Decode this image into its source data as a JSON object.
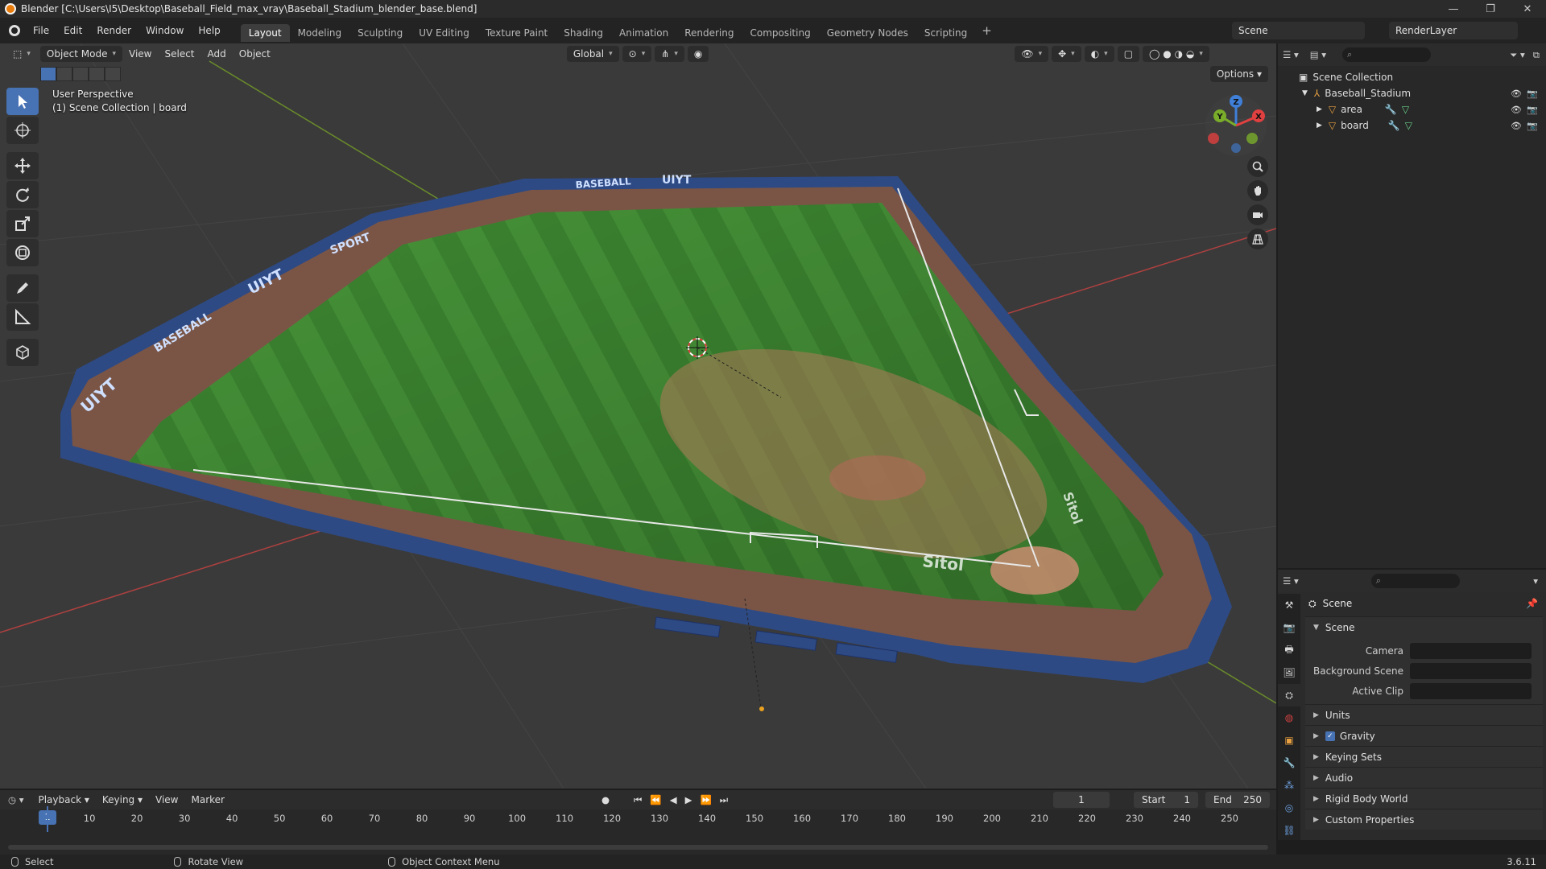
{
  "window": {
    "title": "Blender [C:\\Users\\I5\\Desktop\\Baseball_Field_max_vray\\Baseball_Stadium_blender_base.blend]",
    "controls": [
      "—",
      "❐",
      "✕"
    ]
  },
  "menubar": {
    "items": [
      "File",
      "Edit",
      "Render",
      "Window",
      "Help"
    ],
    "workspaces": [
      "Layout",
      "Modeling",
      "Sculpting",
      "UV Editing",
      "Texture Paint",
      "Shading",
      "Animation",
      "Rendering",
      "Compositing",
      "Geometry Nodes",
      "Scripting"
    ],
    "active_workspace": "Layout",
    "add_label": "+",
    "scene": "Scene",
    "view_layer": "RenderLayer"
  },
  "viewport": {
    "mode": "Object Mode",
    "menus": [
      "View",
      "Select",
      "Add",
      "Object"
    ],
    "orientation": "Global",
    "options_label": "Options",
    "overlay_line1": "User Perspective",
    "overlay_line2": "(1) Scene Collection | board",
    "gizmo": {
      "x": "X",
      "y": "Y",
      "z": "Z"
    },
    "field_text": {
      "banner1": "UIYT",
      "banner2": "BASEBALL",
      "banner3": "UIYT",
      "banner4": "SPORT",
      "banner5": "BASEBALL",
      "banner6": "UIYT",
      "logo_main": "Sitol",
      "logo_side": "Sitol"
    },
    "colors": {
      "grass": "#3e8a32",
      "dirt": "#7a5546",
      "wall": "#2e4a84",
      "bg": "#3a3a3a"
    }
  },
  "outliner": {
    "root": "Scene Collection",
    "collection": "Baseball_Stadium",
    "objects": [
      "area",
      "board"
    ]
  },
  "properties": {
    "title": "Scene",
    "section_scene": "Scene",
    "fields": [
      {
        "label": "Camera"
      },
      {
        "label": "Background Scene"
      },
      {
        "label": "Active Clip"
      }
    ],
    "sections": [
      "Units",
      "Gravity",
      "Keying Sets",
      "Audio",
      "Rigid Body World",
      "Custom Properties"
    ],
    "gravity_checked": true
  },
  "timeline": {
    "menus": [
      "Playback",
      "Keying",
      "View",
      "Marker"
    ],
    "current_frame": "1",
    "start_label": "Start",
    "start": "1",
    "end_label": "End",
    "end": "250",
    "ticks": [
      "10",
      "20",
      "30",
      "40",
      "50",
      "60",
      "70",
      "80",
      "90",
      "100",
      "110",
      "120",
      "130",
      "140",
      "150",
      "160",
      "170",
      "180",
      "190",
      "200",
      "210",
      "220",
      "230",
      "240",
      "250"
    ]
  },
  "statusbar": {
    "hints": [
      "Select",
      "Rotate View",
      "Object Context Menu"
    ],
    "version": "3.6.11"
  }
}
